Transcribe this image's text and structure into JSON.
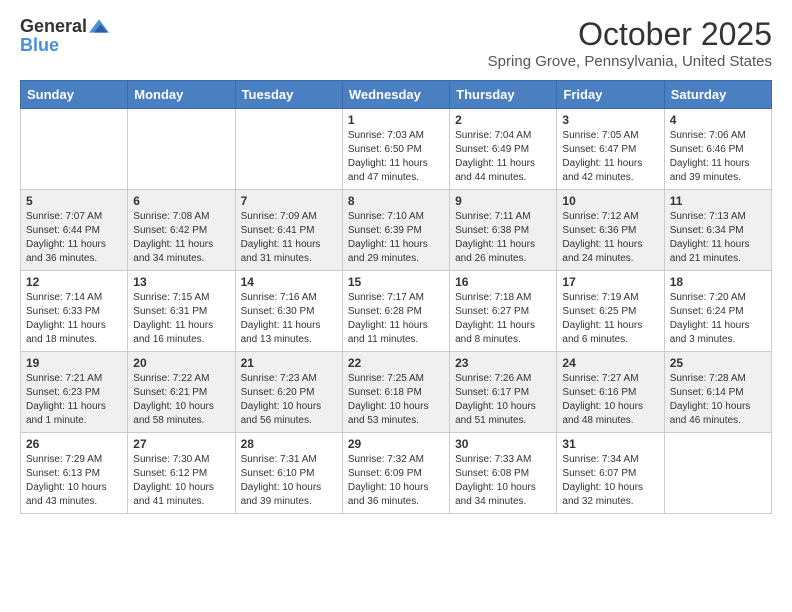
{
  "header": {
    "logo_general": "General",
    "logo_blue": "Blue",
    "month": "October 2025",
    "location": "Spring Grove, Pennsylvania, United States"
  },
  "weekdays": [
    "Sunday",
    "Monday",
    "Tuesday",
    "Wednesday",
    "Thursday",
    "Friday",
    "Saturday"
  ],
  "weeks": [
    [
      {
        "day": "",
        "info": ""
      },
      {
        "day": "",
        "info": ""
      },
      {
        "day": "",
        "info": ""
      },
      {
        "day": "1",
        "info": "Sunrise: 7:03 AM\nSunset: 6:50 PM\nDaylight: 11 hours and 47 minutes."
      },
      {
        "day": "2",
        "info": "Sunrise: 7:04 AM\nSunset: 6:49 PM\nDaylight: 11 hours and 44 minutes."
      },
      {
        "day": "3",
        "info": "Sunrise: 7:05 AM\nSunset: 6:47 PM\nDaylight: 11 hours and 42 minutes."
      },
      {
        "day": "4",
        "info": "Sunrise: 7:06 AM\nSunset: 6:46 PM\nDaylight: 11 hours and 39 minutes."
      }
    ],
    [
      {
        "day": "5",
        "info": "Sunrise: 7:07 AM\nSunset: 6:44 PM\nDaylight: 11 hours and 36 minutes."
      },
      {
        "day": "6",
        "info": "Sunrise: 7:08 AM\nSunset: 6:42 PM\nDaylight: 11 hours and 34 minutes."
      },
      {
        "day": "7",
        "info": "Sunrise: 7:09 AM\nSunset: 6:41 PM\nDaylight: 11 hours and 31 minutes."
      },
      {
        "day": "8",
        "info": "Sunrise: 7:10 AM\nSunset: 6:39 PM\nDaylight: 11 hours and 29 minutes."
      },
      {
        "day": "9",
        "info": "Sunrise: 7:11 AM\nSunset: 6:38 PM\nDaylight: 11 hours and 26 minutes."
      },
      {
        "day": "10",
        "info": "Sunrise: 7:12 AM\nSunset: 6:36 PM\nDaylight: 11 hours and 24 minutes."
      },
      {
        "day": "11",
        "info": "Sunrise: 7:13 AM\nSunset: 6:34 PM\nDaylight: 11 hours and 21 minutes."
      }
    ],
    [
      {
        "day": "12",
        "info": "Sunrise: 7:14 AM\nSunset: 6:33 PM\nDaylight: 11 hours and 18 minutes."
      },
      {
        "day": "13",
        "info": "Sunrise: 7:15 AM\nSunset: 6:31 PM\nDaylight: 11 hours and 16 minutes."
      },
      {
        "day": "14",
        "info": "Sunrise: 7:16 AM\nSunset: 6:30 PM\nDaylight: 11 hours and 13 minutes."
      },
      {
        "day": "15",
        "info": "Sunrise: 7:17 AM\nSunset: 6:28 PM\nDaylight: 11 hours and 11 minutes."
      },
      {
        "day": "16",
        "info": "Sunrise: 7:18 AM\nSunset: 6:27 PM\nDaylight: 11 hours and 8 minutes."
      },
      {
        "day": "17",
        "info": "Sunrise: 7:19 AM\nSunset: 6:25 PM\nDaylight: 11 hours and 6 minutes."
      },
      {
        "day": "18",
        "info": "Sunrise: 7:20 AM\nSunset: 6:24 PM\nDaylight: 11 hours and 3 minutes."
      }
    ],
    [
      {
        "day": "19",
        "info": "Sunrise: 7:21 AM\nSunset: 6:23 PM\nDaylight: 11 hours and 1 minute."
      },
      {
        "day": "20",
        "info": "Sunrise: 7:22 AM\nSunset: 6:21 PM\nDaylight: 10 hours and 58 minutes."
      },
      {
        "day": "21",
        "info": "Sunrise: 7:23 AM\nSunset: 6:20 PM\nDaylight: 10 hours and 56 minutes."
      },
      {
        "day": "22",
        "info": "Sunrise: 7:25 AM\nSunset: 6:18 PM\nDaylight: 10 hours and 53 minutes."
      },
      {
        "day": "23",
        "info": "Sunrise: 7:26 AM\nSunset: 6:17 PM\nDaylight: 10 hours and 51 minutes."
      },
      {
        "day": "24",
        "info": "Sunrise: 7:27 AM\nSunset: 6:16 PM\nDaylight: 10 hours and 48 minutes."
      },
      {
        "day": "25",
        "info": "Sunrise: 7:28 AM\nSunset: 6:14 PM\nDaylight: 10 hours and 46 minutes."
      }
    ],
    [
      {
        "day": "26",
        "info": "Sunrise: 7:29 AM\nSunset: 6:13 PM\nDaylight: 10 hours and 43 minutes."
      },
      {
        "day": "27",
        "info": "Sunrise: 7:30 AM\nSunset: 6:12 PM\nDaylight: 10 hours and 41 minutes."
      },
      {
        "day": "28",
        "info": "Sunrise: 7:31 AM\nSunset: 6:10 PM\nDaylight: 10 hours and 39 minutes."
      },
      {
        "day": "29",
        "info": "Sunrise: 7:32 AM\nSunset: 6:09 PM\nDaylight: 10 hours and 36 minutes."
      },
      {
        "day": "30",
        "info": "Sunrise: 7:33 AM\nSunset: 6:08 PM\nDaylight: 10 hours and 34 minutes."
      },
      {
        "day": "31",
        "info": "Sunrise: 7:34 AM\nSunset: 6:07 PM\nDaylight: 10 hours and 32 minutes."
      },
      {
        "day": "",
        "info": ""
      }
    ]
  ]
}
